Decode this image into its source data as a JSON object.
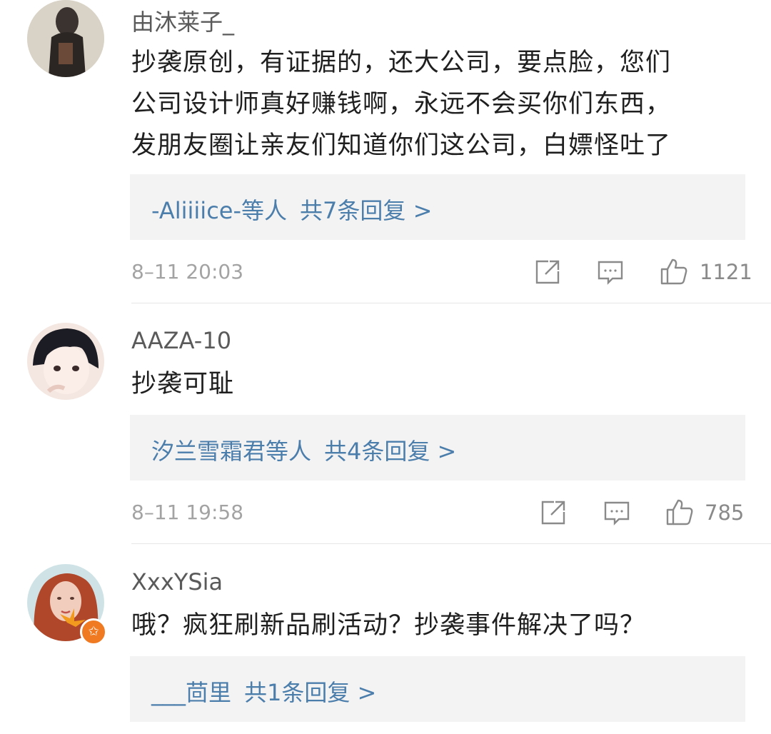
{
  "comments": [
    {
      "username": "由沐莱子_",
      "lines": [
        "抄袭原创，有证据的，还大公司，要点脸，您们",
        "公司设计师真好赚钱啊，永远不会买你们东西，",
        "发朋友圈让亲友们知道你们这公司，白嫖怪吐了"
      ],
      "reply_users": "-Aliiiice-等人",
      "reply_count": "共7条回复 >",
      "time": "8–11 20:03",
      "likes": "1121"
    },
    {
      "username": "AAZA-10",
      "lines": [
        "抄袭可耻"
      ],
      "reply_users": "汐兰雪霜君等人",
      "reply_count": "共4条回复 >",
      "time": "8–11 19:58",
      "likes": "785"
    },
    {
      "username": "XxxYSia",
      "lines": [
        "哦？疯狂刷新品刷活动？抄袭事件解决了吗？"
      ],
      "reply_users": "___茴里",
      "reply_count": "共1条回复 >",
      "badge": "✩"
    }
  ],
  "icons": {
    "share": "share-icon",
    "comment": "comment-icon",
    "like": "thumbs-up-icon"
  },
  "colors": {
    "link": "#4c7eac",
    "reply_bg": "#f3f3f3",
    "badge": "#f07a22"
  }
}
